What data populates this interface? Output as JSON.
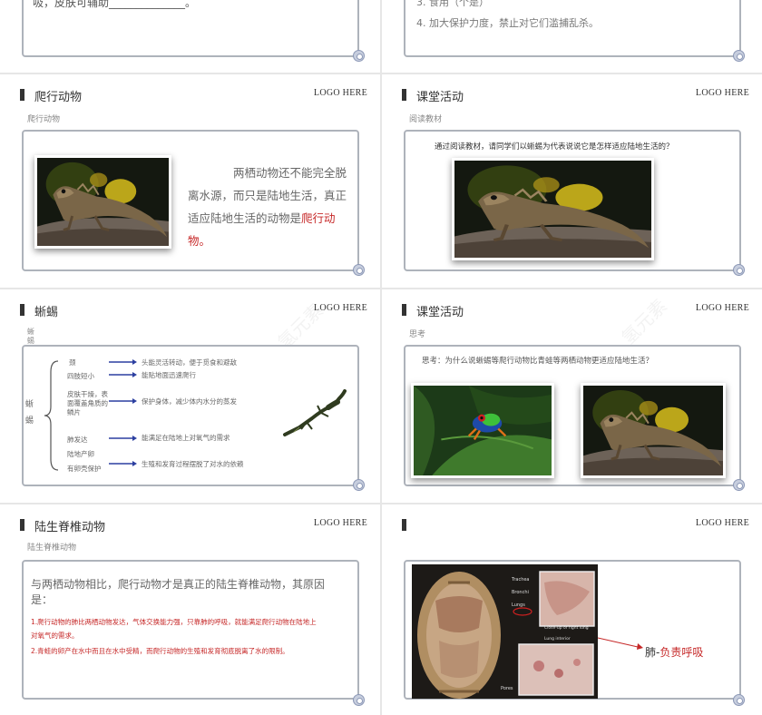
{
  "s1": {
    "text": "吸，皮肤可辅助______________。"
  },
  "s2": {
    "item3": "3. 食用（个是）",
    "item4": "4. 加大保护力度，禁止对它们滥捕乱杀。"
  },
  "s3": {
    "title": "爬行动物",
    "logo": "LOGO HERE",
    "subtitle": "爬行动物",
    "body": "两栖动物还不能完全脱离水源，而只是陆地生活，真正适应陆地生活的动物是",
    "highlight": "爬行动物。"
  },
  "s4": {
    "title": "课堂活动",
    "logo": "LOGO HERE",
    "subtitle": "阅读教材",
    "question": "通过阅读教材，请同学们以蜥蜴为代表说说它是怎样适应陆地生活的？"
  },
  "s5": {
    "title": "蜥蜴",
    "logo": "LOGO HERE",
    "side_top": "蜥蜴",
    "root": "蜥蜴",
    "rows": [
      {
        "left": "颈",
        "right": "头能灵活转动，便于觅食和避敌"
      },
      {
        "left": "四肢短小",
        "right": "能贴地面迅速爬行"
      },
      {
        "left": "皮肤干燥，表面覆盖角质的鳞片",
        "right": "保护身体，减少体内水分的蒸发"
      },
      {
        "left": "肺发达",
        "right": "能满足在陆地上对氧气的需求"
      },
      {
        "left": "陆地产卵",
        "right": ""
      },
      {
        "left": "有卵壳保护",
        "right": "生殖和发育过程摆脱了对水的依赖"
      }
    ]
  },
  "s6": {
    "title": "课堂活动",
    "logo": "LOGO HERE",
    "subtitle": "思考",
    "question": "思考：为什么说蜥蜴等爬行动物比青蛙等两栖动物更适应陆地生活？"
  },
  "s7": {
    "title": "陆生脊椎动物",
    "logo": "LOGO HERE",
    "subtitle": "陆生脊椎动物",
    "lead": "与两栖动物相比，爬行动物才是真正的陆生脊椎动物，其原因是：",
    "p1": "1.爬行动物的肺比两栖动物发达，气体交换能力强，只靠肺的呼吸，就能满足爬行动物在陆地上对氧气的需求。",
    "p2": "2.青蛙的卵产在水中而且在水中受精，而爬行动物的生殖和发育彻底脱离了水的限制。"
  },
  "s8": {
    "logo": "LOGO HERE",
    "label_prefix": "肺-",
    "label_red": "负责呼吸",
    "photo_labels": [
      "Trachea",
      "Bronchi",
      "Lungs",
      "Close-up of right lung",
      "Lung interior",
      "Pores"
    ]
  },
  "watermark": "氢元素",
  "colors": {
    "frame": "#aeb3bb",
    "accent_red": "#c62828",
    "arrow_blue": "#2c3fa0"
  }
}
